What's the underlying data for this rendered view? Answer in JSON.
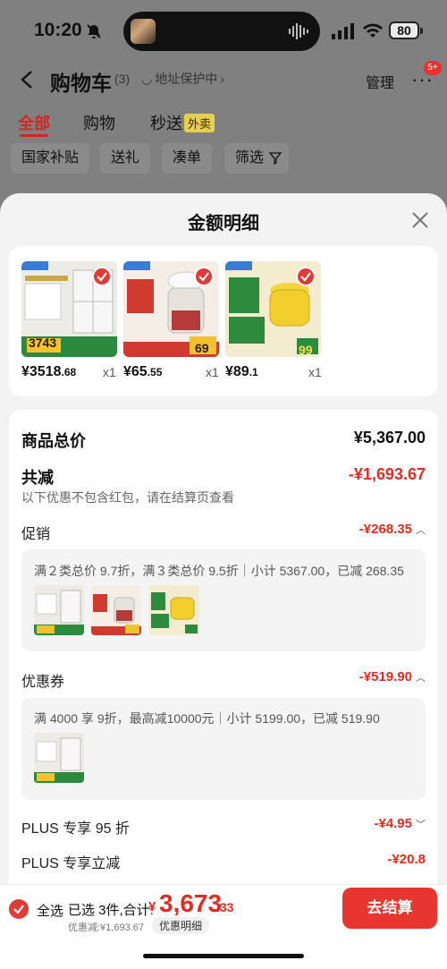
{
  "status_bar": {
    "time": "10:20",
    "battery": "80"
  },
  "header": {
    "title": "购物车",
    "count": "(3)",
    "address": "地址保护中",
    "manage": "管理",
    "more": "···",
    "more_badge": "5+"
  },
  "tabs": [
    {
      "label": "全部"
    },
    {
      "label": "购物"
    },
    {
      "label": "秒送"
    }
  ],
  "tab_badge": "外卖",
  "filters": [
    {
      "label": "国家补贴"
    },
    {
      "label": "送礼"
    },
    {
      "label": "凑单"
    },
    {
      "label": "筛选"
    }
  ],
  "sheet": {
    "title": "金额明细"
  },
  "products": [
    {
      "price_int": "¥3518",
      "price_dec": ".68",
      "qty": "x1",
      "tag": "3743"
    },
    {
      "price_int": "¥65",
      "price_dec": ".55",
      "qty": "x1",
      "tag": "69"
    },
    {
      "price_int": "¥89",
      "price_dec": ".1",
      "qty": "x1",
      "tag": "99"
    }
  ],
  "summary": {
    "goods_total_label": "商品总价",
    "goods_total": "¥5,367.00",
    "reduce_label": "共减",
    "reduce_total": "-¥1,693.67",
    "reduce_note": "以下优惠不包含红包，请在结算页查看"
  },
  "promotion": {
    "label": "促销",
    "value": "-¥268.35",
    "desc": "满２类总价 9.7折，满３类总价 9.5折｜小计 5367.00，已减 268.35"
  },
  "coupon": {
    "label": "优惠券",
    "value": "-¥519.90",
    "desc": "满 4000 享 9折，最高减10000元｜小计 5199.00，已减 519.90"
  },
  "plus95": {
    "label": "PLUS 专享 95 折",
    "value": "-¥4.95"
  },
  "plusinstant": {
    "label": "PLUS 专享立减",
    "value": "-¥20.8"
  },
  "bottom": {
    "select_all": "全选",
    "selected": "已选 3件,合计:",
    "sym": "¥",
    "total_int": "3,673",
    "total_dec": ".33",
    "saved": "优惠减:¥1,693.67",
    "detail": "优惠明细",
    "checkout": "去结算"
  },
  "colors": {
    "accent": "#e02c23",
    "checkout": "#e8352f",
    "sheet_bg": "#f3f3f3",
    "overlay": "#808080"
  }
}
